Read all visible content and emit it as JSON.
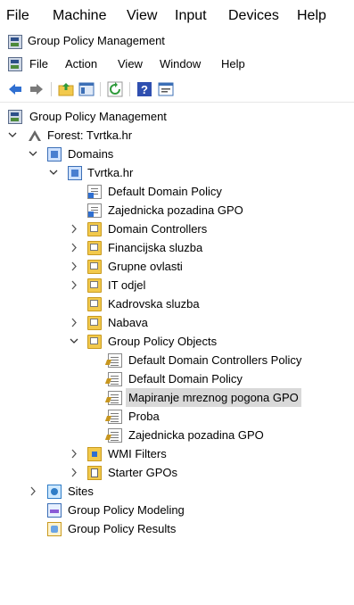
{
  "vbox_menu": [
    "File",
    "Machine",
    "View",
    "Input",
    "Devices",
    "Help"
  ],
  "window": {
    "title": "Group Policy Management"
  },
  "app_menu": [
    "File",
    "Action",
    "View",
    "Window",
    "Help"
  ],
  "toolbar": {
    "icons": [
      "back-arrow-icon",
      "forward-arrow-icon",
      "up-folder-icon",
      "show-hide-console-tree-icon",
      "refresh-icon",
      "help-icon",
      "properties-icon"
    ]
  },
  "tree": {
    "root": "Group Policy Management",
    "forest": "Forest: Tvrtka.hr",
    "domains": "Domains",
    "domain": "Tvrtka.hr",
    "children": [
      "Default Domain Policy",
      "Zajednicka pozadina GPO",
      "Domain Controllers",
      "Financijska sluzba",
      "Grupne ovlasti",
      "IT odjel",
      "Kadrovska sluzba",
      "Nabava",
      "Group Policy Objects"
    ],
    "gpos": [
      "Default Domain Controllers Policy",
      "Default Domain Policy",
      "Mapiranje mreznog pogona GPO",
      "Proba",
      "Zajednicka pozadina GPO"
    ],
    "wmi": "WMI Filters",
    "starter": "Starter GPOs",
    "sites": "Sites",
    "modeling": "Group Policy Modeling",
    "results": "Group Policy Results",
    "selected": "Mapiranje mreznog pogona GPO"
  },
  "colors": {
    "selection": "#d9d9d9",
    "folder": "#f2c94c",
    "toolbar_blue": "#2f6fd1"
  }
}
